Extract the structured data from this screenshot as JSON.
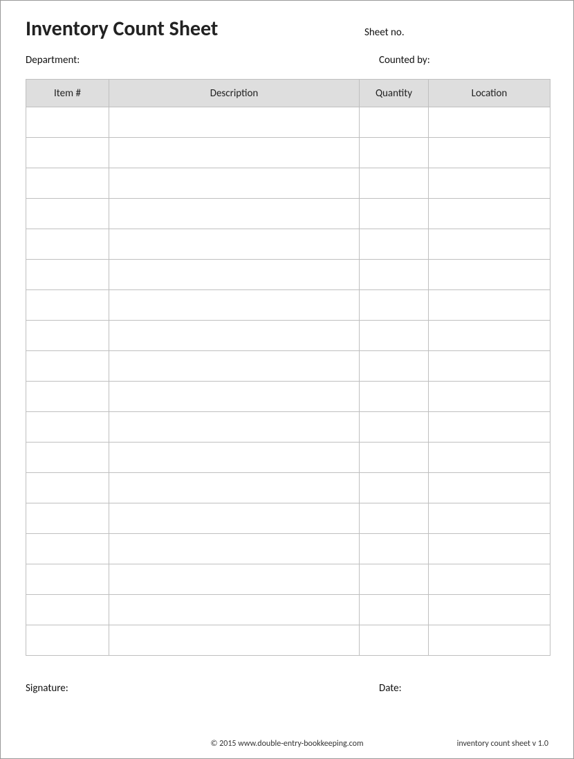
{
  "header": {
    "title": "Inventory Count Sheet",
    "sheet_no_label": "Sheet no."
  },
  "meta": {
    "department_label": "Department:",
    "counted_by_label": "Counted by:"
  },
  "table": {
    "columns": {
      "item": "Item #",
      "description": "Description",
      "quantity": "Quantity",
      "location": "Location"
    },
    "rows": [
      {
        "item": "",
        "description": "",
        "quantity": "",
        "location": ""
      },
      {
        "item": "",
        "description": "",
        "quantity": "",
        "location": ""
      },
      {
        "item": "",
        "description": "",
        "quantity": "",
        "location": ""
      },
      {
        "item": "",
        "description": "",
        "quantity": "",
        "location": ""
      },
      {
        "item": "",
        "description": "",
        "quantity": "",
        "location": ""
      },
      {
        "item": "",
        "description": "",
        "quantity": "",
        "location": ""
      },
      {
        "item": "",
        "description": "",
        "quantity": "",
        "location": ""
      },
      {
        "item": "",
        "description": "",
        "quantity": "",
        "location": ""
      },
      {
        "item": "",
        "description": "",
        "quantity": "",
        "location": ""
      },
      {
        "item": "",
        "description": "",
        "quantity": "",
        "location": ""
      },
      {
        "item": "",
        "description": "",
        "quantity": "",
        "location": ""
      },
      {
        "item": "",
        "description": "",
        "quantity": "",
        "location": ""
      },
      {
        "item": "",
        "description": "",
        "quantity": "",
        "location": ""
      },
      {
        "item": "",
        "description": "",
        "quantity": "",
        "location": ""
      },
      {
        "item": "",
        "description": "",
        "quantity": "",
        "location": ""
      },
      {
        "item": "",
        "description": "",
        "quantity": "",
        "location": ""
      },
      {
        "item": "",
        "description": "",
        "quantity": "",
        "location": ""
      },
      {
        "item": "",
        "description": "",
        "quantity": "",
        "location": ""
      }
    ]
  },
  "signature": {
    "signature_label": "Signature:",
    "date_label": "Date:"
  },
  "footer": {
    "copyright": "© 2015 www.double-entry-bookkeeping.com",
    "version": "inventory count sheet v 1.0"
  }
}
